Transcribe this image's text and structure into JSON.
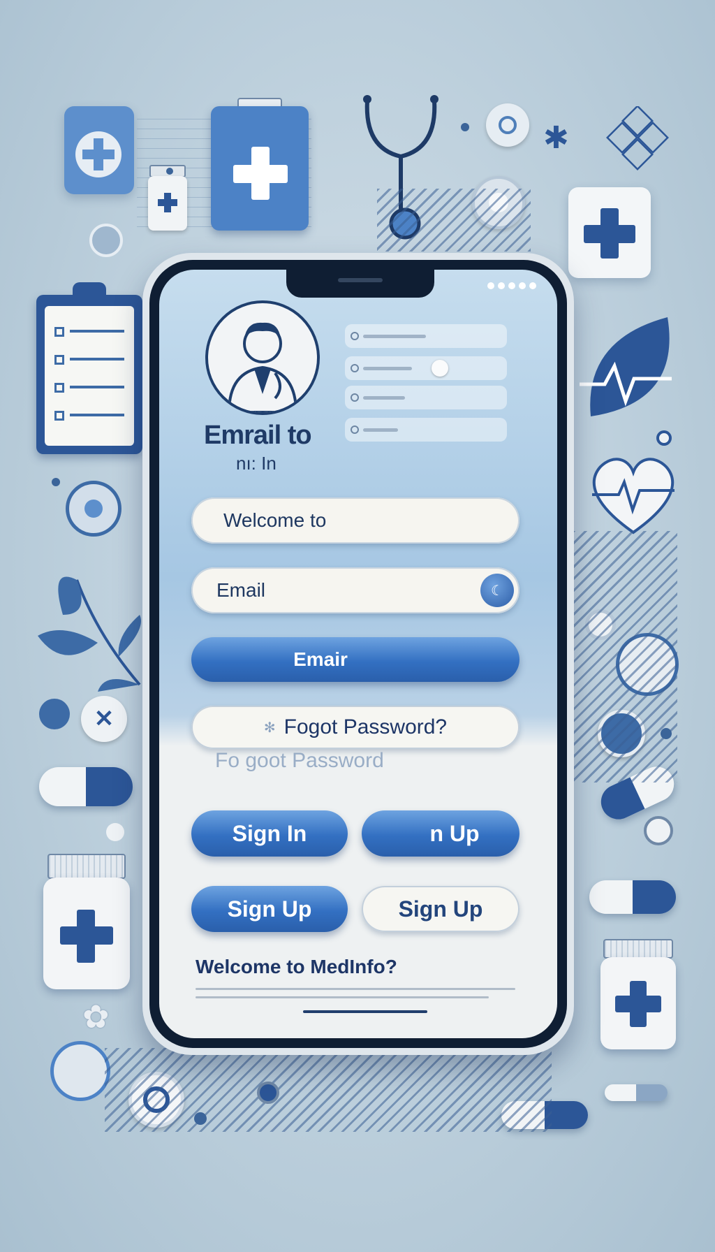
{
  "screen": {
    "heading": "Emrail to",
    "subheading": "nı: In",
    "fields": {
      "welcome_placeholder": "Welcome to",
      "email_placeholder": "Email"
    },
    "email_button": "Emair",
    "forgot_button": "Fogot Password?",
    "forgot_ghost": "Fo goot Password",
    "sign_in": "Sign In",
    "sign_up_top_right": "n Up",
    "sign_up_primary": "Sign Up",
    "sign_up_secondary": "Sign Up",
    "footer": "Welcome to MedInfo?"
  },
  "icons": {
    "avatar": "doctor-avatar-icon",
    "email_field_action": "location-pin-icon",
    "forgot_prefix": "asterisk-icon"
  },
  "colors": {
    "primary": "#3370c2",
    "navy": "#1f3a66",
    "background": "#bccfdc"
  }
}
